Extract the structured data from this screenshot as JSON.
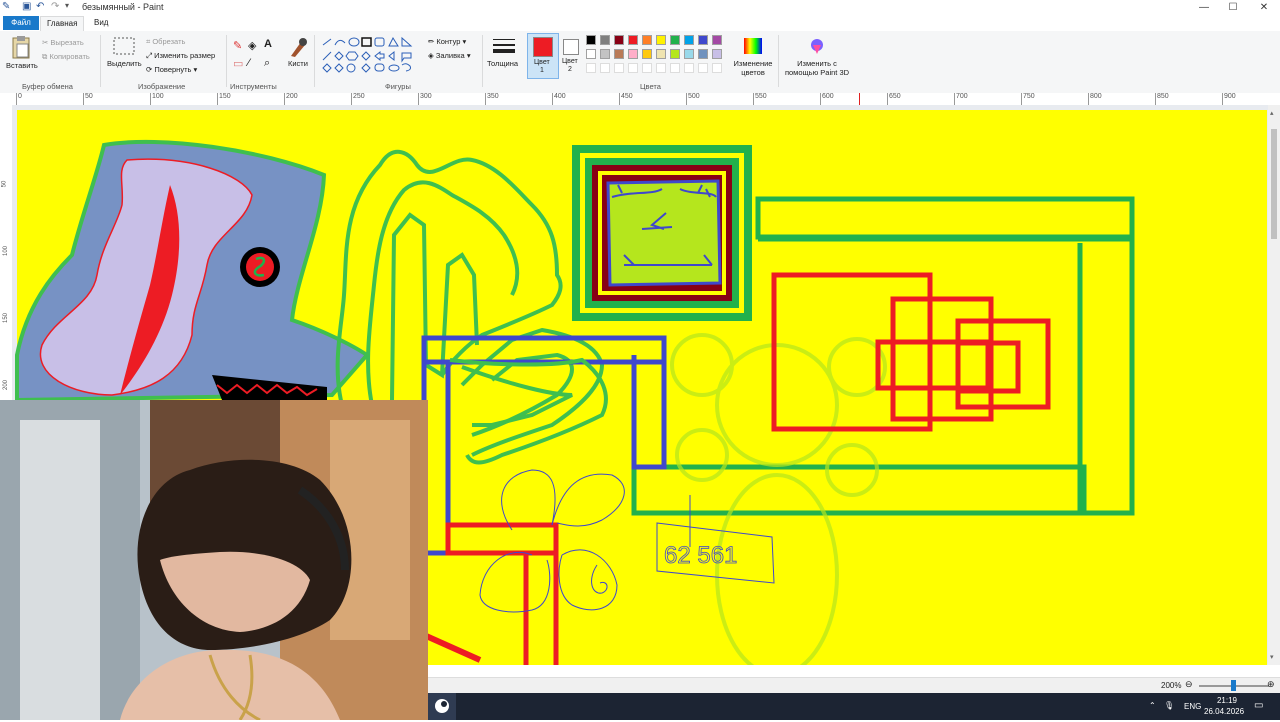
{
  "window": {
    "title": "безымянный - Paint",
    "controls": {
      "minimize": "—",
      "maximize": "☐",
      "close": "✕"
    }
  },
  "menu": {
    "file": "Файл",
    "home": "Главная",
    "view": "Вид"
  },
  "ribbon": {
    "clipboard": {
      "paste": "Вставить",
      "cut": "Вырезать",
      "copy": "Копировать",
      "group": "Буфер обмена"
    },
    "image": {
      "select": "Выделить",
      "crop": "Обрезать",
      "resize": "Изменить размер",
      "rotate": "Повернуть",
      "group": "Изображение"
    },
    "tools": {
      "brushes": "Кисти",
      "group": "Инструменты"
    },
    "shapes": {
      "outline": "Контур",
      "fill": "Заливка",
      "group": "Фигуры"
    },
    "size": "Толщина",
    "color1": {
      "label": "Цвет",
      "num": "1"
    },
    "color2": {
      "label": "Цвет",
      "num": "2"
    },
    "edit_colors": "Изменение цветов",
    "paint3d": "Изменить с помощью Paint 3D",
    "colors_group": "Цвета"
  },
  "palette": {
    "row1": [
      "#000000",
      "#7f7f7f",
      "#880015",
      "#ed1c24",
      "#ff7f27",
      "#fff200",
      "#22b14c",
      "#00a2e8",
      "#3f48cc",
      "#a349a4"
    ],
    "row2": [
      "#ffffff",
      "#c3c3c3",
      "#b97a57",
      "#ffaec9",
      "#ffc90e",
      "#efe4b0",
      "#b5e61d",
      "#99d9ea",
      "#7092be",
      "#c8bfe7"
    ],
    "color1": "#ed1c24",
    "color2": "#ffffff"
  },
  "ruler": {
    "top": [
      "0",
      "50",
      "100",
      "150",
      "200",
      "250",
      "300",
      "350",
      "400",
      "450",
      "500",
      "550",
      "600",
      "650",
      "700",
      "750",
      "800",
      "850",
      "900"
    ],
    "left": [
      "50",
      "100",
      "150",
      "200"
    ]
  },
  "canvas": {
    "bg": "#ffff00",
    "number_text": "62 561"
  },
  "status": {
    "zoom": "200%"
  },
  "taskbar": {
    "lang": "ENG",
    "time": "21:19",
    "date": "26.04.2026"
  }
}
